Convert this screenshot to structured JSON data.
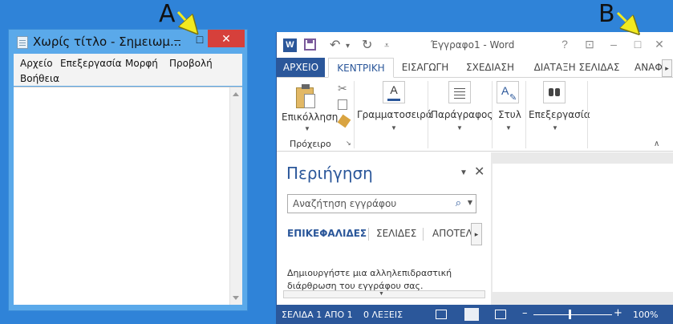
{
  "annotations": {
    "a": "A",
    "b": "B"
  },
  "colors": {
    "desktop": "#2f83d8",
    "word_accent": "#2b579a",
    "close_red": "#d6403b"
  },
  "notepad": {
    "title": "Χωρίς τίτλο - Σημειωμ...",
    "controls": {
      "minimize_icon": "minimize-icon",
      "maximize_icon": "maximize-icon",
      "close_icon": "close-icon",
      "minimize": "–",
      "maximize": "□",
      "close": "✕"
    },
    "menu": [
      "Αρχείο",
      "Επεξεργασία",
      "Μορφή",
      "Προβολή",
      "Βοήθεια"
    ]
  },
  "word": {
    "title": "Έγγραφο1 - Word",
    "titlebar_buttons": {
      "help": "?",
      "ribbon_display": "⊡",
      "minimize": "–",
      "maximize": "□",
      "close": "✕"
    },
    "tabs": [
      "ΑΡΧΕΙΟ",
      "ΚΕΝΤΡΙΚΗ",
      "ΕΙΣΑΓΩΓΗ",
      "ΣΧΕΔΙΑΣΗ",
      "ΔΙΑΤΑΞΗ ΣΕΛΙΔΑΣ",
      "ΑΝΑΦ"
    ],
    "active_tab": "ΚΕΝΤΡΙΚΗ",
    "ribbon": {
      "paste": "Επικόλληση",
      "clipboard_group": "Πρόχειρο",
      "font": "Γραμματοσειρά",
      "paragraph": "Παράγραφος",
      "styles": "Στυλ",
      "editing": "Επεξεργασία"
    },
    "nav": {
      "title": "Περιήγηση",
      "search_placeholder": "Αναζήτηση εγγράφου",
      "subtabs": [
        "ΕΠΙΚΕΦΑΛΙΔΕΣ",
        "ΣΕΛΙΔΕΣ",
        "ΑΠΟΤΕΛ"
      ],
      "message": "Δημιουργήστε μια αλληλεπιδραστική διάρθρωση του εγγράφου σας."
    },
    "status": {
      "page": "ΣΕΛΙΔΑ 1 ΑΠΟ 1",
      "words": "0 ΛΕΞΕΙΣ",
      "zoom_minus": "–",
      "zoom_plus": "+",
      "zoom": "100%"
    }
  }
}
